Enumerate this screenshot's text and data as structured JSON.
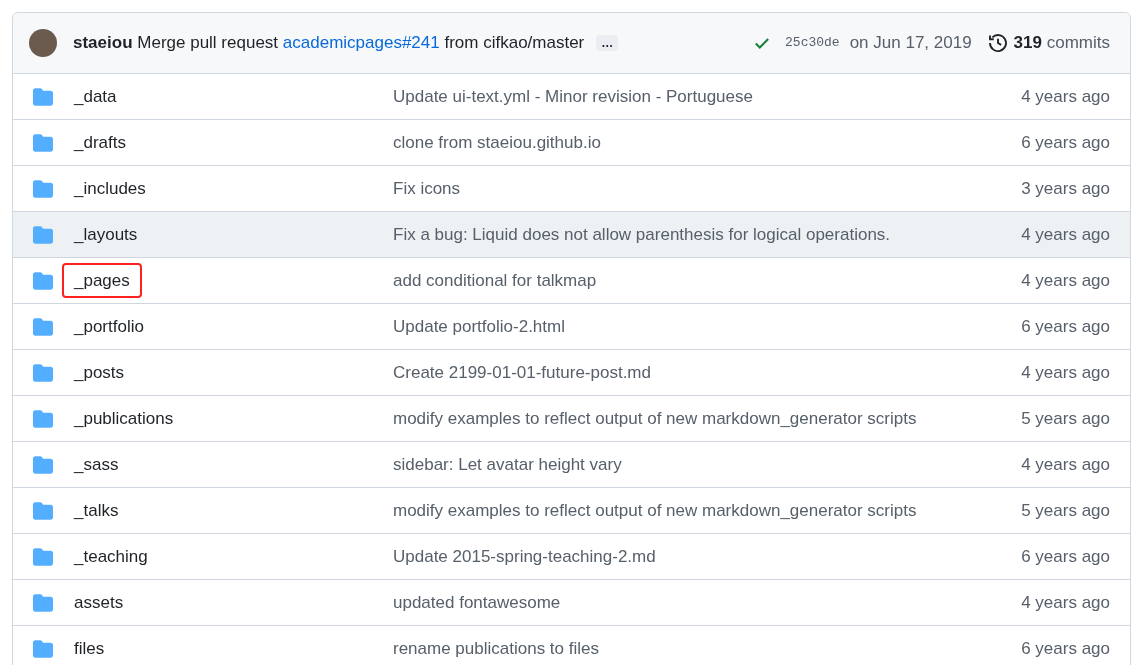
{
  "commit": {
    "author": "staeiou",
    "message_before": "Merge pull request",
    "link": "academicpages#241",
    "message_after": "from cifkao/master",
    "ellipsis": "…",
    "checks_passed": true,
    "sha": "25c30de",
    "date": "on Jun 17, 2019",
    "count": "319",
    "count_label": "commits"
  },
  "files": [
    {
      "name": "_data",
      "message": "Update ui-text.yml - Minor revision - Portuguese",
      "age": "4 years ago",
      "highlighted": false,
      "marked": false
    },
    {
      "name": "_drafts",
      "message": "clone from staeiou.github.io",
      "age": "6 years ago",
      "highlighted": false,
      "marked": false
    },
    {
      "name": "_includes",
      "message": "Fix icons",
      "age": "3 years ago",
      "highlighted": false,
      "marked": false
    },
    {
      "name": "_layouts",
      "message": "Fix a bug: Liquid does not allow parenthesis for logical operations.",
      "age": "4 years ago",
      "highlighted": true,
      "marked": false
    },
    {
      "name": "_pages",
      "message": "add conditional for talkmap",
      "age": "4 years ago",
      "highlighted": false,
      "marked": true
    },
    {
      "name": "_portfolio",
      "message": "Update portfolio-2.html",
      "age": "6 years ago",
      "highlighted": false,
      "marked": false
    },
    {
      "name": "_posts",
      "message": "Create 2199-01-01-future-post.md",
      "age": "4 years ago",
      "highlighted": false,
      "marked": false
    },
    {
      "name": "_publications",
      "message": "modify examples to reflect output of new markdown_generator scripts",
      "age": "5 years ago",
      "highlighted": false,
      "marked": false
    },
    {
      "name": "_sass",
      "message": "sidebar: Let avatar height vary",
      "age": "4 years ago",
      "highlighted": false,
      "marked": false
    },
    {
      "name": "_talks",
      "message": "modify examples to reflect output of new markdown_generator scripts",
      "age": "5 years ago",
      "highlighted": false,
      "marked": false
    },
    {
      "name": "_teaching",
      "message": "Update 2015-spring-teaching-2.md",
      "age": "6 years ago",
      "highlighted": false,
      "marked": false
    },
    {
      "name": "assets",
      "message": "updated fontawesome",
      "age": "4 years ago",
      "highlighted": false,
      "marked": false
    },
    {
      "name": "files",
      "message": "rename publications to files",
      "age": "6 years ago",
      "highlighted": false,
      "marked": false
    }
  ]
}
